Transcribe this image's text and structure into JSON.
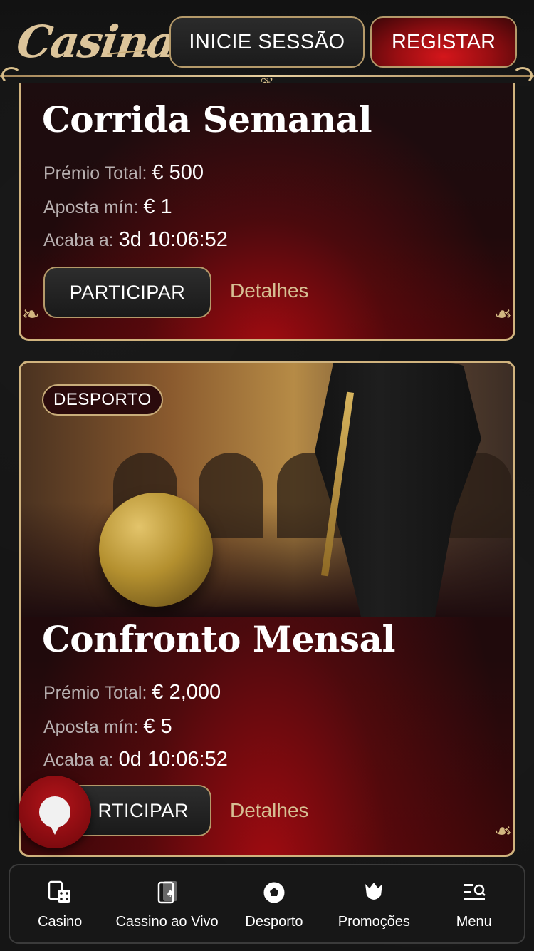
{
  "header": {
    "logo_text": "Casina",
    "login_label": "INICIE SESSÃO",
    "register_label": "REGISTAR"
  },
  "tournaments": [
    {
      "title": "Corrida Semanal",
      "prize_label": "Prémio Total:",
      "prize_value": "€ 500",
      "min_bet_label": "Aposta mín:",
      "min_bet_value": "€ 1",
      "ends_label": "Acaba a:",
      "ends_value": "3d 10:06:52",
      "join_label": "PARTICIPAR",
      "details_label": "Detalhes"
    },
    {
      "badge": "DESPORTO",
      "title": "Confronto Mensal",
      "prize_label": "Prémio Total:",
      "prize_value": "€ 2,000",
      "min_bet_label": "Aposta mín:",
      "min_bet_value": "€ 5",
      "ends_label": "Acaba a:",
      "ends_value": "0d 10:06:52",
      "join_label": "RTICIPAR",
      "details_label": "Detalhes"
    }
  ],
  "bottom_nav": [
    {
      "label": "Casino",
      "icon": "dice-cards-icon"
    },
    {
      "label": "Cassino ao Vivo",
      "icon": "playing-card-icon"
    },
    {
      "label": "Desporto",
      "icon": "soccer-ball-icon"
    },
    {
      "label": "Promoções",
      "icon": "tulip-icon"
    },
    {
      "label": "Menu",
      "icon": "menu-search-icon"
    }
  ],
  "colors": {
    "gold": "#d0b37e",
    "accent_red": "#c8141a",
    "background": "#151515"
  }
}
